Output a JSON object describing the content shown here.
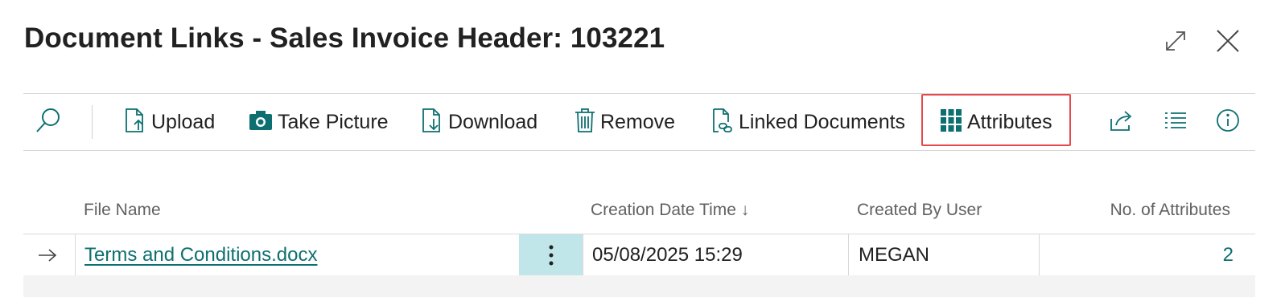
{
  "window": {
    "title": "Document Links - Sales Invoice Header: 103221",
    "expand_icon": "expand-icon",
    "close_icon": "close-icon"
  },
  "toolbar": {
    "search_icon": "search-icon",
    "actions": [
      {
        "label": "Upload",
        "icon": "upload-icon"
      },
      {
        "label": "Take Picture",
        "icon": "camera-icon"
      },
      {
        "label": "Download",
        "icon": "download-icon"
      },
      {
        "label": "Remove",
        "icon": "trash-icon"
      },
      {
        "label": "Linked Documents",
        "icon": "linked-docs-icon"
      },
      {
        "label": "Attributes",
        "icon": "grid-icon"
      }
    ],
    "right_icons": [
      "share-icon",
      "list-icon",
      "info-icon"
    ]
  },
  "table": {
    "columns": [
      "File Name",
      "Creation Date Time",
      "Created By User",
      "No. of Attributes"
    ],
    "sort_indicator": "↓",
    "rows": [
      {
        "file_name": "Terms and Conditions.docx",
        "creation_date_time": "05/08/2025 15:29",
        "created_by_user": "MEGAN",
        "no_of_attributes": "2"
      }
    ]
  },
  "colors": {
    "accent": "#0e6f70",
    "highlight": "#e5484d",
    "selected_cell": "#c1e6ea"
  }
}
